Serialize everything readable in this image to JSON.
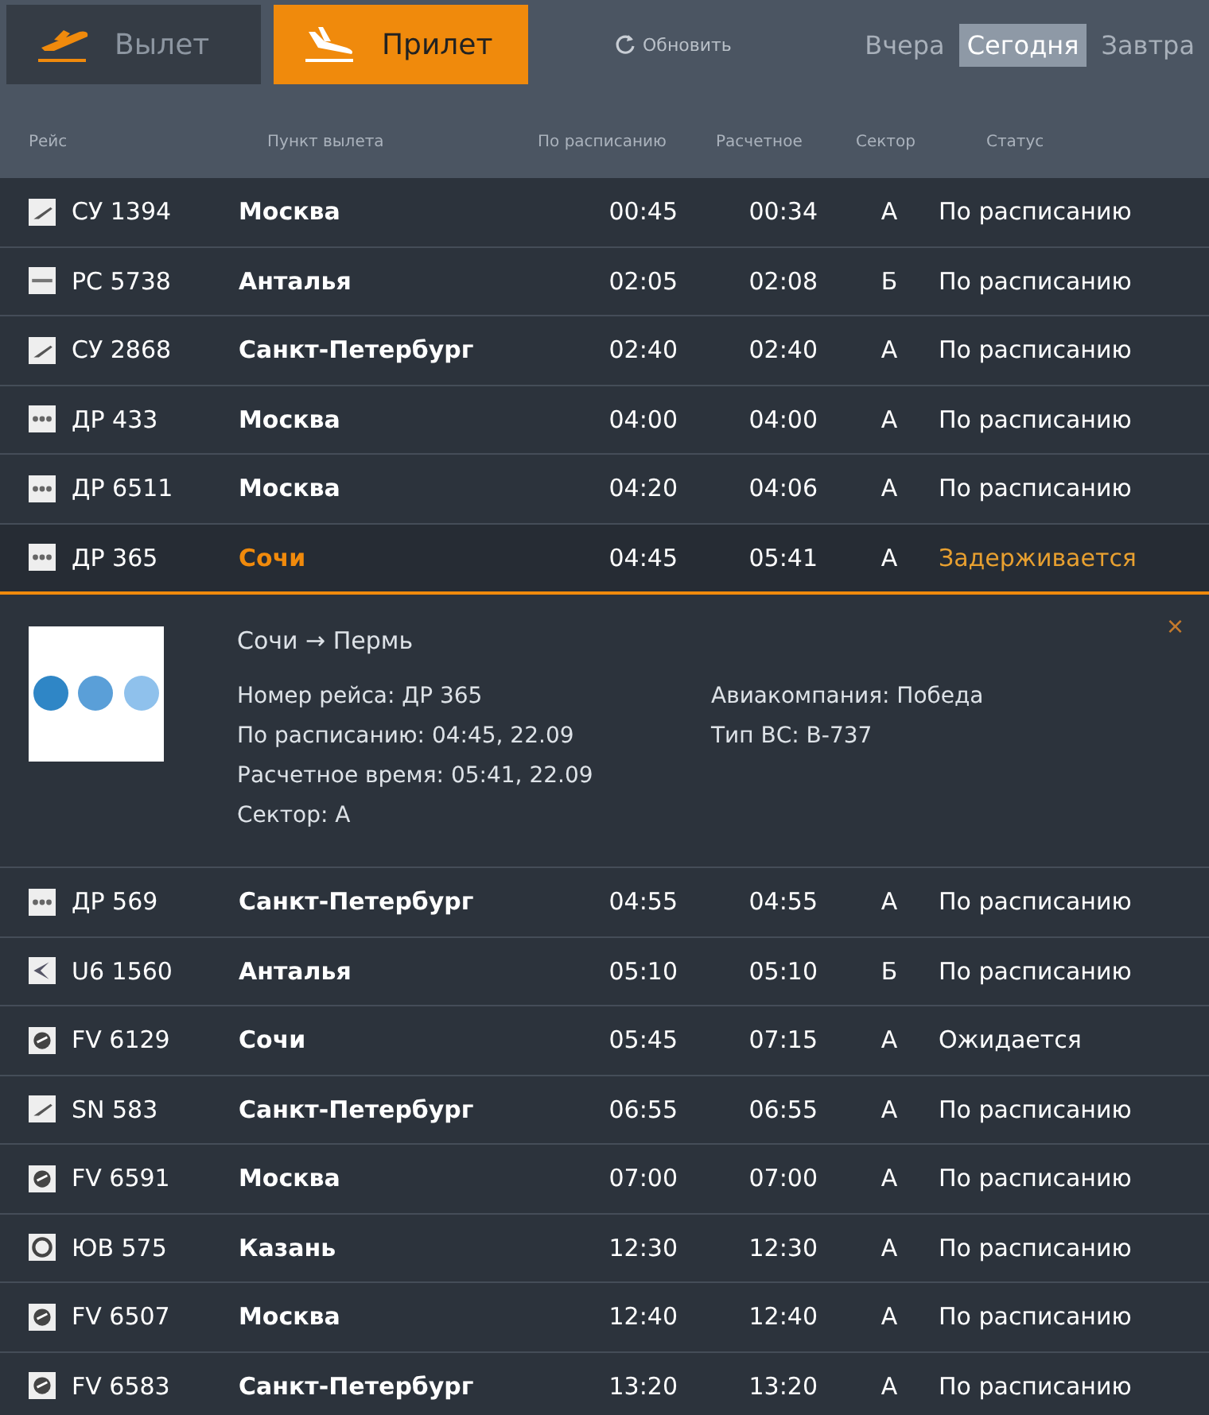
{
  "tabs": [
    {
      "label": "Вылет",
      "kind": "departure",
      "selected": false
    },
    {
      "label": "Прилет",
      "kind": "arrival",
      "selected": true
    }
  ],
  "refresh": "Обновить",
  "days": [
    {
      "label": "Вчера",
      "selected": false
    },
    {
      "label": "Сегодня",
      "selected": true
    },
    {
      "label": "Завтра",
      "selected": false
    }
  ],
  "columns": [
    "Рейс",
    "Пункт вылета",
    "По расписанию",
    "Расчетное",
    "Сектор",
    "Статус"
  ],
  "rows": [
    {
      "kind": "plane",
      "flight": "СУ 1394",
      "city": "Москва",
      "scheduled": "00:45",
      "estimated": "00:34",
      "sector": "A",
      "status": "По расписанию",
      "delayed": false,
      "expanded": false
    },
    {
      "kind": "stripe",
      "flight": "РС 5738",
      "city": "Анталья",
      "scheduled": "02:05",
      "estimated": "02:08",
      "sector": "Б",
      "status": "По расписанию",
      "delayed": false,
      "expanded": false
    },
    {
      "kind": "plane",
      "flight": "СУ 2868",
      "city": "Санкт-Петербург",
      "scheduled": "02:40",
      "estimated": "02:40",
      "sector": "A",
      "status": "По расписанию",
      "delayed": false,
      "expanded": false
    },
    {
      "kind": "dots",
      "flight": "ДР 433",
      "city": "Москва",
      "scheduled": "04:00",
      "estimated": "04:00",
      "sector": "A",
      "status": "По расписанию",
      "delayed": false,
      "expanded": false
    },
    {
      "kind": "dots",
      "flight": "ДР 6511",
      "city": "Москва",
      "scheduled": "04:20",
      "estimated": "04:06",
      "sector": "A",
      "status": "По расписанию",
      "delayed": false,
      "expanded": false
    },
    {
      "kind": "dots",
      "flight": "ДР 365",
      "city": "Сочи",
      "scheduled": "04:45",
      "estimated": "05:41",
      "sector": "A",
      "status": "Задерживается",
      "delayed": true,
      "expanded": true,
      "detail": {
        "route": "Сочи → Пермь",
        "close": "×",
        "left": [
          "Номер рейса: ДР 365",
          "По расписанию: 04:45, 22.09",
          "Расчетное время: 05:41, 22.09",
          "Сектор: А"
        ],
        "right": [
          "Авиакомпания: Победа",
          "Тип ВС: B-737"
        ]
      }
    },
    {
      "kind": "dots",
      "flight": "ДР 569",
      "city": "Санкт-Петербург",
      "scheduled": "04:55",
      "estimated": "04:55",
      "sector": "A",
      "status": "По расписанию",
      "delayed": false,
      "expanded": false
    },
    {
      "kind": "swoosh",
      "flight": "U6 1560",
      "city": "Анталья",
      "scheduled": "05:10",
      "estimated": "05:10",
      "sector": "Б",
      "status": "По расписанию",
      "delayed": false,
      "expanded": false
    },
    {
      "kind": "circle",
      "flight": "FV 6129",
      "city": "Сочи",
      "scheduled": "05:45",
      "estimated": "07:15",
      "sector": "A",
      "status": "Ожидается",
      "delayed": false,
      "expanded": false
    },
    {
      "kind": "plane",
      "flight": "SN 583",
      "city": "Санкт-Петербург",
      "scheduled": "06:55",
      "estimated": "06:55",
      "sector": "A",
      "status": "По расписанию",
      "delayed": false,
      "expanded": false
    },
    {
      "kind": "circle",
      "flight": "FV 6591",
      "city": "Москва",
      "scheduled": "07:00",
      "estimated": "07:00",
      "sector": "A",
      "status": "По расписанию",
      "delayed": false,
      "expanded": false
    },
    {
      "kind": "ring",
      "flight": "ЮВ 575",
      "city": "Казань",
      "scheduled": "12:30",
      "estimated": "12:30",
      "sector": "A",
      "status": "По расписанию",
      "delayed": false,
      "expanded": false
    },
    {
      "kind": "circle",
      "flight": "FV 6507",
      "city": "Москва",
      "scheduled": "12:40",
      "estimated": "12:40",
      "sector": "A",
      "status": "По расписанию",
      "delayed": false,
      "expanded": false
    },
    {
      "kind": "circle",
      "flight": "FV 6583",
      "city": "Санкт-Петербург",
      "scheduled": "13:20",
      "estimated": "13:20",
      "sector": "A",
      "status": "По расписанию",
      "delayed": false,
      "expanded": false
    }
  ]
}
